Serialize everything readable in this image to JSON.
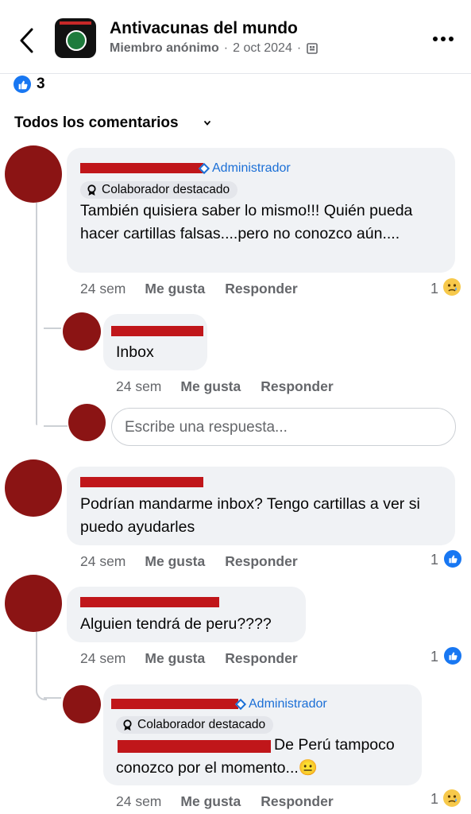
{
  "header": {
    "group_name": "Antivacunas del mundo",
    "author": "Miembro anónimo",
    "separator": "·",
    "date": "2 oct 2024",
    "privacy_icon": "group-members-icon",
    "back_icon": "back-chevron-icon",
    "more_icon": "more-options-icon"
  },
  "reactions": {
    "count": "3",
    "icon": "like-icon"
  },
  "comments_filter": {
    "label": "Todos los comentarios",
    "icon": "chevron-down-icon"
  },
  "comments": [
    {
      "author_badge": "Administrador",
      "contributor_badge": "Colaborador destacado",
      "text": "También quisiera saber lo mismo!!! Quién pueda hacer cartillas falsas....pero no conozco aún....",
      "time": "24 sem",
      "like_label": "Me gusta",
      "reply_label": "Responder",
      "reaction_count": "1",
      "reaction_type": "sad"
    },
    {
      "text": "Inbox",
      "time": "24 sem",
      "like_label": "Me gusta",
      "reply_label": "Responder"
    },
    {
      "text": "Podrían mandarme inbox? Tengo cartillas a ver si puedo ayudarles",
      "time": "24 sem",
      "like_label": "Me gusta",
      "reply_label": "Responder",
      "reaction_count": "1",
      "reaction_type": "like"
    },
    {
      "text": "Alguien tendrá de peru????",
      "time": "24 sem",
      "like_label": "Me gusta",
      "reply_label": "Responder",
      "reaction_count": "1",
      "reaction_type": "like"
    },
    {
      "author_badge": "Administrador",
      "contributor_badge": "Colaborador destacado",
      "text_part1": "De Perú tampoco",
      "text_part2": "conozco por el momento...",
      "emoji": "😐",
      "time": "24 sem",
      "like_label": "Me gusta",
      "reply_label": "Responder",
      "reaction_count": "1",
      "reaction_type": "sad"
    }
  ],
  "reply_input": {
    "placeholder": "Escribe una respuesta..."
  },
  "colors": {
    "accent": "#1877f2",
    "redaction": "#c0161a",
    "avatar": "#8b1414",
    "bubble": "#f0f2f5"
  }
}
